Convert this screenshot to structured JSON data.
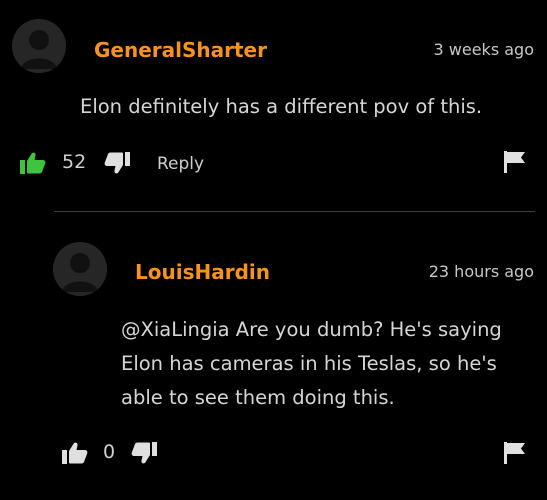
{
  "comments": [
    {
      "username": "GeneralSharter",
      "timestamp": "3 weeks ago",
      "text": "Elon definitely has a different pov of this.",
      "votes": "52",
      "reply_label": "Reply",
      "liked": true
    },
    {
      "username": "LouisHardin",
      "timestamp": "23 hours ago",
      "text": "@XiaLingia Are you dumb? He's saying Elon has cameras in his Teslas, so he's able to see them doing this.",
      "votes": "0",
      "liked": false
    }
  ],
  "colors": {
    "background": "#000000",
    "username": "#f7931e",
    "thumbs_up_active": "#3ec43e",
    "icon": "#e0e0e0"
  },
  "icons": [
    "avatar-icon",
    "thumbs-up-icon",
    "thumbs-down-icon",
    "flag-icon"
  ]
}
